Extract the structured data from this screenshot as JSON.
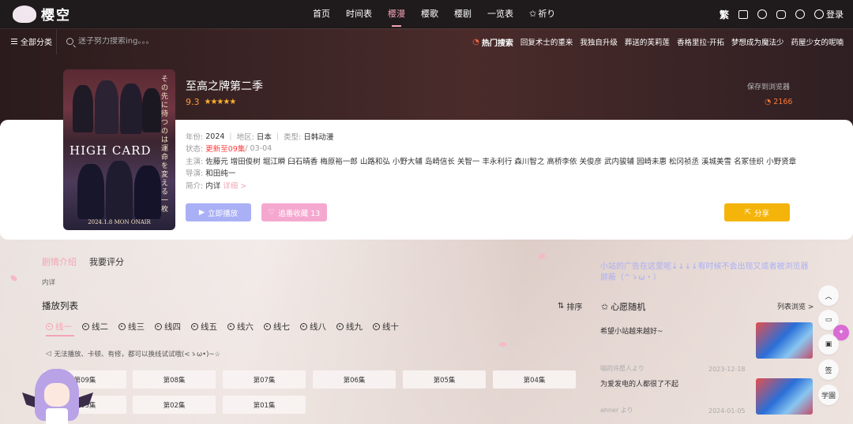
{
  "site": {
    "logo_text": "樱空"
  },
  "nav": {
    "items": [
      "首页",
      "时间表",
      "樱漫",
      "樱歌",
      "樱剧",
      "一览表",
      "祈り"
    ],
    "active_index": 2
  },
  "tools": {
    "lang": "繁",
    "login": "登录"
  },
  "subbar": {
    "all_categories": "全部分类",
    "search_placeholder": "迷子努力搜索ing。。。",
    "hot_label": "热门搜索",
    "hot_items": [
      "回复术士的重来",
      "我独自升级",
      "葬送的芙莉莲",
      "香格里拉·开拓",
      "梦想成为魔法少",
      "药屋少女的呢喃"
    ]
  },
  "anime": {
    "title": "至高之牌第二季",
    "score": "9.3",
    "stars": "★★★★★",
    "save_label": "保存到浏览器",
    "views": "2166",
    "year_label": "年份:",
    "year": "2024",
    "region_label": "地区:",
    "region": "日本",
    "type_label": "类型:",
    "type": "日韩动漫",
    "status_label": "状态:",
    "status": "更新至09集",
    "status_date": " / 03-04",
    "cast_label": "主演:",
    "cast": "佐藤元 增田俊树 堀江瞬 臼石晴香 梅原裕一郎 山路和弘 小野大辅 岛崎信长 关智一 丰永利行 森川智之 高桥李依 关俊彦 武内骏辅 园崎未惠 松冈祯丞 溪城美雪 名冢佳织 小野贤章",
    "director_label": "导演:",
    "director": "和田纯一",
    "summary_label": "简介:",
    "summary": "内详",
    "summary_more": "详细 >",
    "poster_title": "HIGH CARD",
    "poster_vertical": "その先に待つのは運命を変える一枚",
    "poster_date": "2024.1.8 MON ONAIR"
  },
  "buttons": {
    "play": "立即播放",
    "fav": "追番收藏 13",
    "share": "分享"
  },
  "section": {
    "tab_intro": "剧情介绍",
    "tab_rate": "我要评分",
    "intro_text": "内详",
    "playlist_title": "播放列表",
    "sort": "排序",
    "lines": [
      "线一",
      "线二",
      "线三",
      "线四",
      "线五",
      "线六",
      "线七",
      "线八",
      "线九",
      "线十"
    ],
    "notice": "无法播放、卡顿、有修，都可以换线试试哦(<ゝω•)~☆",
    "episodes": [
      "第09集",
      "第08集",
      "第07集",
      "第06集",
      "第05集",
      "第04集",
      "第03集",
      "第02集",
      "第01集"
    ]
  },
  "side": {
    "ad": "小站的广告在这里呢↓↓↓↓有时候不会出现又或者被浏览器屏蔽（^ゝω・）",
    "wish_title": "心愿随机",
    "browse": "列表浏览 >",
    "wishes": [
      {
        "text": "希望小站越来越好~",
        "user": "喵的许愿人より",
        "date": "2023-12-18"
      },
      {
        "text": "为爱发电的人都很了不起",
        "user": "ahner より",
        "date": "2024-01-05"
      }
    ]
  },
  "float_buttons": [
    "学園",
    "签"
  ],
  "colors": {
    "accent_pink": "#f4a3b6",
    "play_purple": "#aab0f5",
    "fav_pink": "#f5a8cf",
    "share_orange": "#f5b40a",
    "score_orange": "#ff9a3c",
    "status_red": "#ff3d3d"
  }
}
